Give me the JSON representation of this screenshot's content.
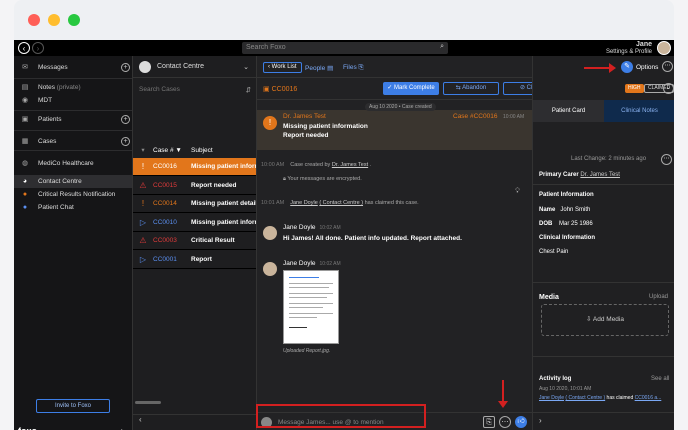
{
  "window": {
    "dots": [
      "#ff5f57",
      "#ffbd2e",
      "#28c840"
    ]
  },
  "topbar": {
    "search_placeholder": "Search Foxo",
    "user_name": "Jane",
    "user_menu": "Settings & Profile"
  },
  "nav": {
    "messages": "Messages",
    "notes": "Notes",
    "notes_private": "(private)",
    "mdt": "MDT",
    "patients": "Patients",
    "cases": "Cases",
    "org": "MediCo Healthcare",
    "items": [
      "Contact Centre",
      "Critical Results Notification",
      "Patient Chat"
    ],
    "invite": "Invite to Foxo",
    "brand": "foxo",
    "collapse": "‹"
  },
  "caselist": {
    "title": "Contact Centre",
    "search_placeholder": "Search Cases",
    "col_case": "Case # ▼",
    "col_subject": "Subject",
    "rows": [
      {
        "id": "CC0016",
        "subject": "Missing patient inform...",
        "status": "!",
        "color": "#ffffff"
      },
      {
        "id": "CC0015",
        "subject": "Report needed",
        "status": "⚠",
        "color": "#e23b3b"
      },
      {
        "id": "CC0014",
        "subject": "Missing patient details",
        "status": "!",
        "color": "#e2761b"
      },
      {
        "id": "CC0010",
        "subject": "Missing patient inform...",
        "status": "▷",
        "color": "#5b8ff0"
      },
      {
        "id": "CC0003",
        "subject": "Critical Result",
        "status": "⚠",
        "color": "#e23b3b"
      },
      {
        "id": "CC0001",
        "subject": "Report",
        "status": "▷",
        "color": "#5b8ff0"
      }
    ]
  },
  "conversation": {
    "work_list": "‹ Work List",
    "people": "People",
    "files": "Files",
    "case_id": "CC0016",
    "mark_complete": "Mark Complete",
    "abandon": "Abandon",
    "close": "Close",
    "date_pill": "Aug 10 2020 • Case created",
    "first_msg": {
      "name": "Dr. James Test",
      "case_ref": "Case #CC0016",
      "time": "10:00 AM",
      "lines": [
        "Missing patient information",
        "Report needed"
      ]
    },
    "sys1": {
      "time": "10:00 AM",
      "text": "Case created by",
      "who": "Dr. James Test",
      "end": "."
    },
    "sys_encrypted": "Your messages are encrypted.",
    "sys2": {
      "time": "10:01 AM",
      "who": "Jane Doyle",
      "org": "( Contact Centre )",
      "text": "has claimed this case."
    },
    "msg2": {
      "name": "Jane Doyle",
      "time": "10:02 AM",
      "text": "Hi James! All done. Patient info updated. Report attached."
    },
    "msg3": {
      "name": "Jane Doyle",
      "time": "10:02 AM",
      "caption": "Uploaded Report.jpg."
    },
    "composer_placeholder": "Message James... use @ to mention"
  },
  "side": {
    "options": "Options",
    "badge_high": "HIGH",
    "badge_claimed": "CLAIMED",
    "tab_patient": "Patient Card",
    "tab_notes": "Clinical Notes",
    "last_change": "Last Change: 2 minutes ago",
    "primary_carer_label": "Primary Carer",
    "primary_carer": "Dr. James Test",
    "patient_info": "Patient Information",
    "name_label": "Name",
    "name": "John Smith",
    "dob_label": "DOB",
    "dob": "Mar 25 1986",
    "clinical_info": "Clinical Information",
    "clinical": "Chest Pain",
    "media": "Media",
    "upload": "Upload",
    "add_media": "Add Media",
    "activity": "Activity log",
    "see_all": "See all",
    "activity_time": "Aug 10 2020, 10:01 AM",
    "activity_who": "Jane Doyle",
    "activity_org": "( Contact Centre )",
    "activity_text": "has claimed",
    "activity_case": "CC0016 a...",
    "collapse": "›"
  }
}
